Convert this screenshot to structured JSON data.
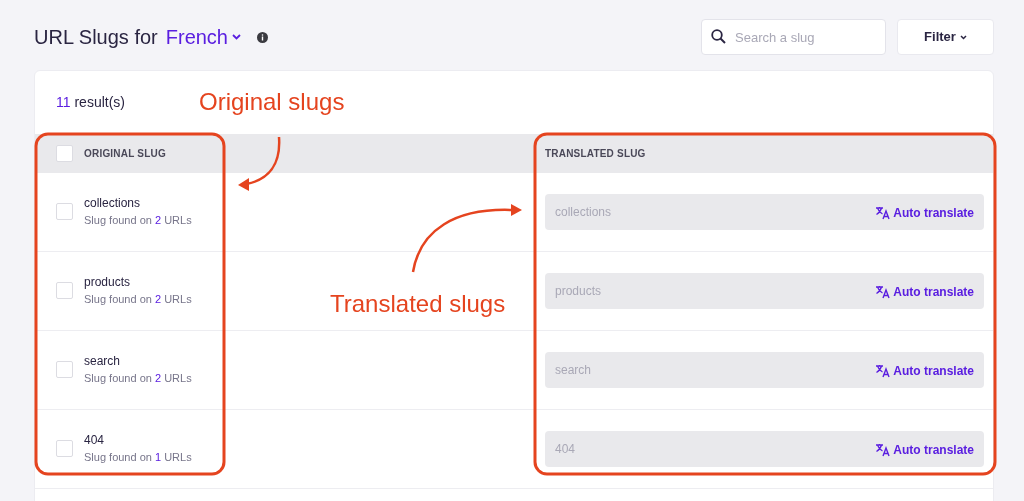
{
  "header": {
    "title": "URL Slugs for",
    "language": "French"
  },
  "search": {
    "placeholder": "Search a slug"
  },
  "filter": {
    "label": "Filter"
  },
  "results": {
    "count": "11",
    "label": "result(s)"
  },
  "table": {
    "select_all": {
      "checked": false
    },
    "columns": [
      "ORIGINAL SLUG",
      "TRANSLATED SLUG"
    ],
    "rows": [
      {
        "checked": false,
        "slug": "collections",
        "usage": {
          "before": "Slug found on",
          "count": "2",
          "after": "URLs"
        },
        "translation_placeholder": "collections",
        "action": "Auto translate"
      },
      {
        "checked": false,
        "slug": "products",
        "usage": {
          "before": "Slug found on",
          "count": "2",
          "after": "URLs"
        },
        "translation_placeholder": "products",
        "action": "Auto translate"
      },
      {
        "checked": false,
        "slug": "search",
        "usage": {
          "before": "Slug found on",
          "count": "2",
          "after": "URLs"
        },
        "translation_placeholder": "search",
        "action": "Auto translate"
      },
      {
        "checked": false,
        "slug": "404",
        "usage": {
          "before": "Slug found on",
          "count": "1",
          "after": "URLs"
        },
        "translation_placeholder": "404",
        "action": "Auto translate"
      }
    ]
  },
  "annotations": [
    {
      "kind": "label",
      "text": "Original slugs"
    },
    {
      "kind": "label",
      "text": "Translated slugs"
    }
  ]
}
